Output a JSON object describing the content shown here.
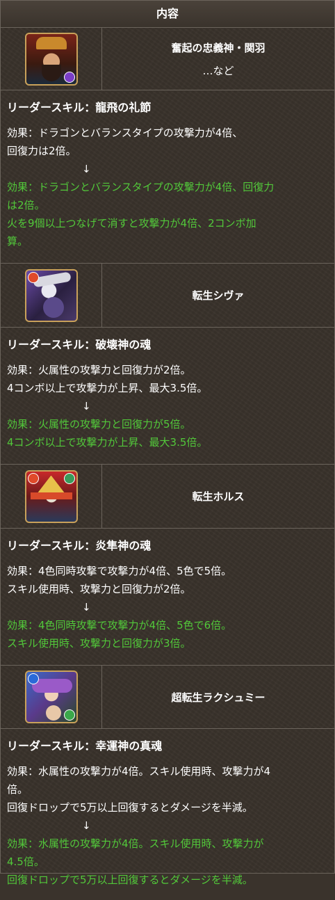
{
  "header": {
    "title": "内容"
  },
  "entries": [
    {
      "name": "奮起の忠義神・関羽",
      "etc": "…など",
      "icon": "guan-yu-monster-icon",
      "skill_title": "リーダースキル：龍飛の礼節",
      "before": [
        "効果：ドラゴンとバランスタイプの攻撃力が4倍、",
        "回復力は2倍。"
      ],
      "arrow": "↓",
      "after": [
        "効果：ドラゴンとバランスタイプの攻撃力が4倍、回復力",
        "は2倍。",
        "火を9個以上つなげて消すと攻撃力が4倍、2コンボ加",
        "算。"
      ]
    },
    {
      "name": "転生シヴァ",
      "icon": "shiva-monster-icon",
      "skill_title": "リーダースキル：破壊神の魂",
      "before": [
        "効果：火属性の攻撃力と回復力が2倍。",
        "4コンボ以上で攻撃力が上昇、最大3.5倍。"
      ],
      "arrow": "↓",
      "after": [
        "効果：火属性の攻撃力と回復力が5倍。",
        "4コンボ以上で攻撃力が上昇、最大3.5倍。"
      ]
    },
    {
      "name": "転生ホルス",
      "icon": "horus-monster-icon",
      "skill_title": "リーダースキル：炎隼神の魂",
      "before": [
        "効果：4色同時攻撃で攻撃力が4倍、5色で5倍。",
        "スキル使用時、攻撃力と回復力が2倍。"
      ],
      "arrow": "↓",
      "after": [
        "効果：4色同時攻撃で攻撃力が4倍、5色で6倍。",
        "スキル使用時、攻撃力と回復力が3倍。"
      ]
    },
    {
      "name": "超転生ラクシュミー",
      "icon": "lakshmi-monster-icon",
      "skill_title": "リーダースキル：幸運神の真魂",
      "before": [
        "効果：水属性の攻撃力が4倍。スキル使用時、攻撃力が4",
        "倍。",
        "回復ドロップで5万以上回復するとダメージを半減。"
      ],
      "arrow": "↓",
      "after": [
        "効果：水属性の攻撃力が4倍。スキル使用時、攻撃力が",
        "4.5倍。",
        "回復ドロップで5万以上回復するとダメージを半減。"
      ]
    }
  ],
  "colors": {
    "improved_text": "#52c83a",
    "border": "#6b645c"
  }
}
